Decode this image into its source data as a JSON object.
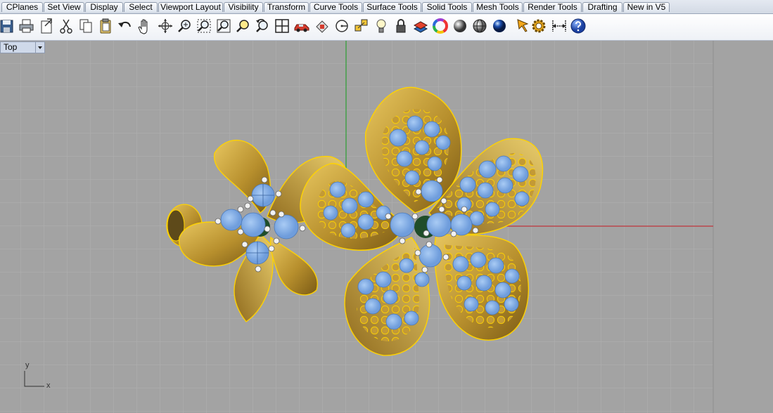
{
  "tabs": [
    {
      "label": "CPlanes"
    },
    {
      "label": "Set View"
    },
    {
      "label": "Display"
    },
    {
      "label": "Select"
    },
    {
      "label": "Viewport Layout"
    },
    {
      "label": "Visibility"
    },
    {
      "label": "Transform"
    },
    {
      "label": "Curve Tools"
    },
    {
      "label": "Surface Tools"
    },
    {
      "label": "Solid Tools"
    },
    {
      "label": "Mesh Tools"
    },
    {
      "label": "Render Tools"
    },
    {
      "label": "Drafting"
    },
    {
      "label": "New in V5"
    }
  ],
  "toolbar": {
    "icons": [
      "save-icon",
      "print-icon",
      "export-icon",
      "cut-icon",
      "copy-icon",
      "paste-icon",
      "undo-icon",
      "pan-hand-icon",
      "rotate-view-icon",
      "zoom-icon",
      "zoom-window-icon",
      "zoom-extents-icon",
      "zoom-selected-icon",
      "undo-view-icon",
      "four-viewports-icon",
      "car-icon",
      "options-icon",
      "circle-snap-icon",
      "points-icon",
      "light-icon",
      "lock-icon",
      "layer-icon",
      "color-wheel-icon",
      "shaded-sphere-icon",
      "wireframe-sphere-icon",
      "rendered-sphere-icon",
      "pointer-icon",
      "gear-icon",
      "dimension-icon",
      "help-icon"
    ]
  },
  "viewport": {
    "title": "Top",
    "axis_y": "y",
    "axis_x": "x",
    "colors": {
      "background": "#a3a3a3",
      "grid": "#b3b3b3",
      "x_axis": "#c0353b",
      "y_axis": "#2e9e35",
      "gold": "#c9a53f",
      "gold_edge": "#ffd300",
      "gem": "#86b1e6"
    }
  }
}
